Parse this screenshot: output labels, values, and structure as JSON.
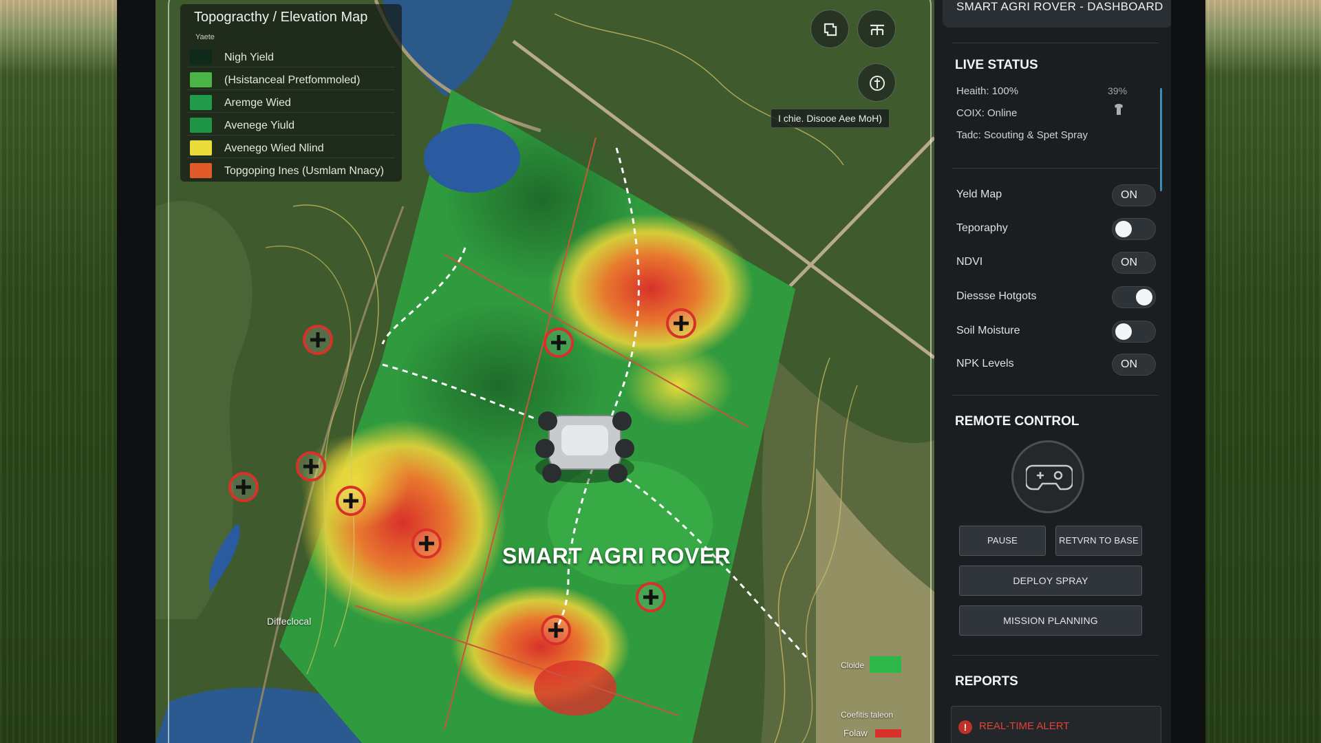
{
  "map": {
    "legend_title": "Topogracthy / Elevation Map",
    "legend_subtitle": "Yaete",
    "legend": [
      {
        "label": "Nigh Yield",
        "color": "#0f2a1a"
      },
      {
        "label": "(Hsistanceal Pretfommoled)",
        "color": "#4cb548"
      },
      {
        "label": "Aremge Wied",
        "color": "#229a4c"
      },
      {
        "label": "Avenege Yiuld",
        "color": "#1e9445"
      },
      {
        "label": "Avenego Wied Nlind",
        "color": "#e8dc3a"
      },
      {
        "label": "Topgoping Ines (Usmlam Nnacy)",
        "color": "#e15a2a"
      }
    ],
    "tooltip": "I chie. Disooe Aee MoH)",
    "rover_label": "SMART AGRI ROVER",
    "label_bottom_left": "Diffeclocal",
    "label_bottom_right_1": "Cloide",
    "label_bottom_right_2": "Coefitis taleon",
    "label_bottom_right_3": "Folaw",
    "buttons": [
      "layers-icon",
      "hierarchy-icon",
      "compass-icon"
    ]
  },
  "panel": {
    "header": "SMART AGRI ROVER - DASHBOARD",
    "live_status": {
      "title": "LIVE STATUS",
      "health": "Heaith: 100%",
      "health_pct": "39%",
      "connection": "COIX: Online",
      "task": "Tadc: Scouting & Spet Spray"
    },
    "layers": [
      {
        "label": "Yeld Map",
        "state": "ON",
        "style": "text"
      },
      {
        "label": "Teporaphy",
        "state": "off",
        "style": "knob-left"
      },
      {
        "label": "NDVI",
        "state": "ON",
        "style": "text"
      },
      {
        "label": "Diessse Hotgots",
        "state": "on",
        "style": "knob-right"
      },
      {
        "label": "Soil Moisture",
        "state": "off",
        "style": "knob-left"
      },
      {
        "label": "NPK Levels",
        "state": "ON",
        "style": "text"
      }
    ],
    "remote_control": {
      "title": "REMOTE CONTROL",
      "pause": "PAUSE",
      "return_to_base": "RETVRN TO BASE",
      "deploy_spray": "DEPLOY SPRAY",
      "mission_planning": "MISSION PLANNING"
    },
    "reports": {
      "title": "REPORTS",
      "alert": "REAL-TIME ALERT"
    }
  },
  "colors": {
    "accent_blue": "#3a8fb8",
    "alert_red": "#e0423a",
    "marker_red": "#d8312a"
  }
}
